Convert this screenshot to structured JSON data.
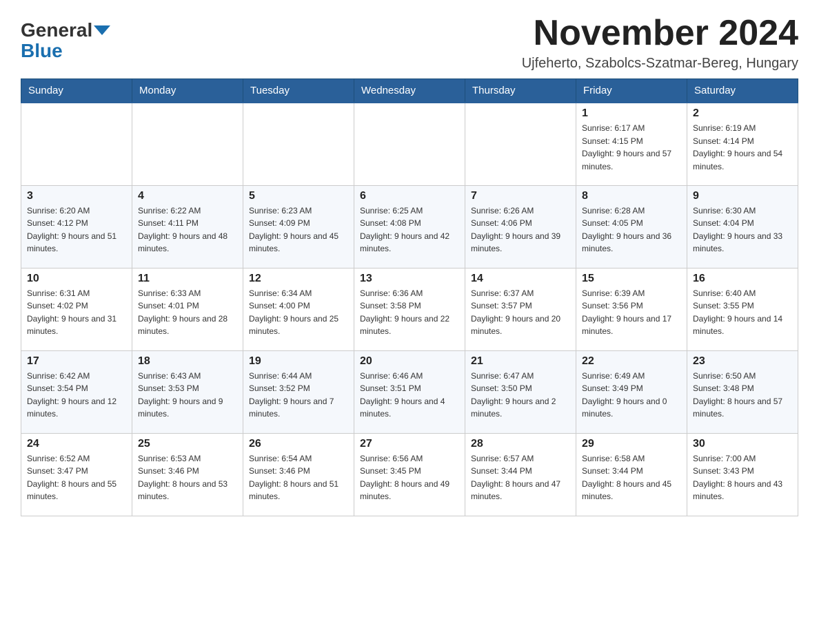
{
  "header": {
    "logo_text_general": "General",
    "logo_text_blue": "Blue",
    "month_title": "November 2024",
    "location": "Ujfeherto, Szabolcs-Szatmar-Bereg, Hungary"
  },
  "weekdays": [
    "Sunday",
    "Monday",
    "Tuesday",
    "Wednesday",
    "Thursday",
    "Friday",
    "Saturday"
  ],
  "weeks": [
    [
      {
        "day": "",
        "sunrise": "",
        "sunset": "",
        "daylight": ""
      },
      {
        "day": "",
        "sunrise": "",
        "sunset": "",
        "daylight": ""
      },
      {
        "day": "",
        "sunrise": "",
        "sunset": "",
        "daylight": ""
      },
      {
        "day": "",
        "sunrise": "",
        "sunset": "",
        "daylight": ""
      },
      {
        "day": "",
        "sunrise": "",
        "sunset": "",
        "daylight": ""
      },
      {
        "day": "1",
        "sunrise": "Sunrise: 6:17 AM",
        "sunset": "Sunset: 4:15 PM",
        "daylight": "Daylight: 9 hours and 57 minutes."
      },
      {
        "day": "2",
        "sunrise": "Sunrise: 6:19 AM",
        "sunset": "Sunset: 4:14 PM",
        "daylight": "Daylight: 9 hours and 54 minutes."
      }
    ],
    [
      {
        "day": "3",
        "sunrise": "Sunrise: 6:20 AM",
        "sunset": "Sunset: 4:12 PM",
        "daylight": "Daylight: 9 hours and 51 minutes."
      },
      {
        "day": "4",
        "sunrise": "Sunrise: 6:22 AM",
        "sunset": "Sunset: 4:11 PM",
        "daylight": "Daylight: 9 hours and 48 minutes."
      },
      {
        "day": "5",
        "sunrise": "Sunrise: 6:23 AM",
        "sunset": "Sunset: 4:09 PM",
        "daylight": "Daylight: 9 hours and 45 minutes."
      },
      {
        "day": "6",
        "sunrise": "Sunrise: 6:25 AM",
        "sunset": "Sunset: 4:08 PM",
        "daylight": "Daylight: 9 hours and 42 minutes."
      },
      {
        "day": "7",
        "sunrise": "Sunrise: 6:26 AM",
        "sunset": "Sunset: 4:06 PM",
        "daylight": "Daylight: 9 hours and 39 minutes."
      },
      {
        "day": "8",
        "sunrise": "Sunrise: 6:28 AM",
        "sunset": "Sunset: 4:05 PM",
        "daylight": "Daylight: 9 hours and 36 minutes."
      },
      {
        "day": "9",
        "sunrise": "Sunrise: 6:30 AM",
        "sunset": "Sunset: 4:04 PM",
        "daylight": "Daylight: 9 hours and 33 minutes."
      }
    ],
    [
      {
        "day": "10",
        "sunrise": "Sunrise: 6:31 AM",
        "sunset": "Sunset: 4:02 PM",
        "daylight": "Daylight: 9 hours and 31 minutes."
      },
      {
        "day": "11",
        "sunrise": "Sunrise: 6:33 AM",
        "sunset": "Sunset: 4:01 PM",
        "daylight": "Daylight: 9 hours and 28 minutes."
      },
      {
        "day": "12",
        "sunrise": "Sunrise: 6:34 AM",
        "sunset": "Sunset: 4:00 PM",
        "daylight": "Daylight: 9 hours and 25 minutes."
      },
      {
        "day": "13",
        "sunrise": "Sunrise: 6:36 AM",
        "sunset": "Sunset: 3:58 PM",
        "daylight": "Daylight: 9 hours and 22 minutes."
      },
      {
        "day": "14",
        "sunrise": "Sunrise: 6:37 AM",
        "sunset": "Sunset: 3:57 PM",
        "daylight": "Daylight: 9 hours and 20 minutes."
      },
      {
        "day": "15",
        "sunrise": "Sunrise: 6:39 AM",
        "sunset": "Sunset: 3:56 PM",
        "daylight": "Daylight: 9 hours and 17 minutes."
      },
      {
        "day": "16",
        "sunrise": "Sunrise: 6:40 AM",
        "sunset": "Sunset: 3:55 PM",
        "daylight": "Daylight: 9 hours and 14 minutes."
      }
    ],
    [
      {
        "day": "17",
        "sunrise": "Sunrise: 6:42 AM",
        "sunset": "Sunset: 3:54 PM",
        "daylight": "Daylight: 9 hours and 12 minutes."
      },
      {
        "day": "18",
        "sunrise": "Sunrise: 6:43 AM",
        "sunset": "Sunset: 3:53 PM",
        "daylight": "Daylight: 9 hours and 9 minutes."
      },
      {
        "day": "19",
        "sunrise": "Sunrise: 6:44 AM",
        "sunset": "Sunset: 3:52 PM",
        "daylight": "Daylight: 9 hours and 7 minutes."
      },
      {
        "day": "20",
        "sunrise": "Sunrise: 6:46 AM",
        "sunset": "Sunset: 3:51 PM",
        "daylight": "Daylight: 9 hours and 4 minutes."
      },
      {
        "day": "21",
        "sunrise": "Sunrise: 6:47 AM",
        "sunset": "Sunset: 3:50 PM",
        "daylight": "Daylight: 9 hours and 2 minutes."
      },
      {
        "day": "22",
        "sunrise": "Sunrise: 6:49 AM",
        "sunset": "Sunset: 3:49 PM",
        "daylight": "Daylight: 9 hours and 0 minutes."
      },
      {
        "day": "23",
        "sunrise": "Sunrise: 6:50 AM",
        "sunset": "Sunset: 3:48 PM",
        "daylight": "Daylight: 8 hours and 57 minutes."
      }
    ],
    [
      {
        "day": "24",
        "sunrise": "Sunrise: 6:52 AM",
        "sunset": "Sunset: 3:47 PM",
        "daylight": "Daylight: 8 hours and 55 minutes."
      },
      {
        "day": "25",
        "sunrise": "Sunrise: 6:53 AM",
        "sunset": "Sunset: 3:46 PM",
        "daylight": "Daylight: 8 hours and 53 minutes."
      },
      {
        "day": "26",
        "sunrise": "Sunrise: 6:54 AM",
        "sunset": "Sunset: 3:46 PM",
        "daylight": "Daylight: 8 hours and 51 minutes."
      },
      {
        "day": "27",
        "sunrise": "Sunrise: 6:56 AM",
        "sunset": "Sunset: 3:45 PM",
        "daylight": "Daylight: 8 hours and 49 minutes."
      },
      {
        "day": "28",
        "sunrise": "Sunrise: 6:57 AM",
        "sunset": "Sunset: 3:44 PM",
        "daylight": "Daylight: 8 hours and 47 minutes."
      },
      {
        "day": "29",
        "sunrise": "Sunrise: 6:58 AM",
        "sunset": "Sunset: 3:44 PM",
        "daylight": "Daylight: 8 hours and 45 minutes."
      },
      {
        "day": "30",
        "sunrise": "Sunrise: 7:00 AM",
        "sunset": "Sunset: 3:43 PM",
        "daylight": "Daylight: 8 hours and 43 minutes."
      }
    ]
  ]
}
